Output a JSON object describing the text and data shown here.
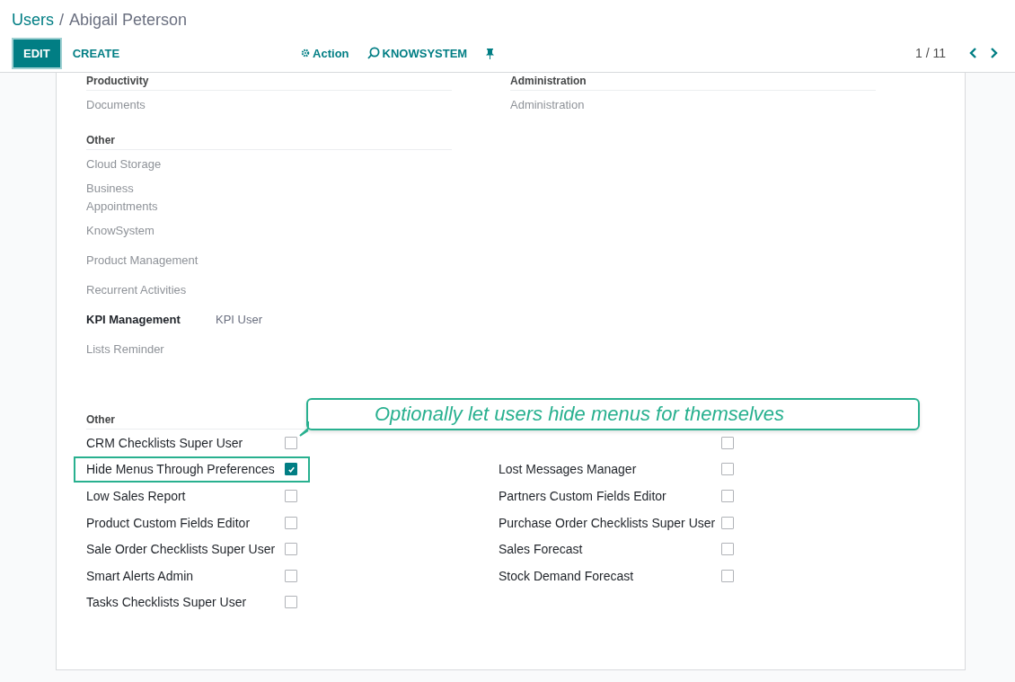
{
  "breadcrumb": {
    "parent": "Users",
    "separator": "/",
    "current": "Abigail Peterson"
  },
  "toolbar": {
    "buttons": [
      {
        "label": "EDIT",
        "kind": "primary"
      },
      {
        "label": "CREATE",
        "kind": "link"
      }
    ],
    "actions": [
      {
        "label": "Action",
        "kind": "gear"
      },
      {
        "label": "KNOWSYSTEM",
        "kind": "knowsystem"
      },
      {
        "kind": "pin"
      }
    ],
    "pager": "1 / 11"
  },
  "upper_sections": [
    {
      "title": "Productivity",
      "fields": [
        {
          "label": "Documents",
          "empty": true
        }
      ]
    },
    {
      "title": "Administration",
      "fields": [
        {
          "label": "Administration",
          "empty": true
        }
      ]
    },
    {
      "title": "Other",
      "fields": [
        {
          "label": "Cloud Storage",
          "empty": true
        },
        {
          "label": "Business Appointments",
          "empty": true
        },
        {
          "label": "KnowSystem",
          "empty": true
        },
        {
          "label": "Product Management",
          "empty": true
        },
        {
          "label": "Recurrent Activities",
          "empty": true
        },
        {
          "label": "KPI Management",
          "empty": false,
          "value": "KPI User"
        },
        {
          "label": "Lists Reminder",
          "empty": true
        }
      ]
    }
  ],
  "other_section": {
    "title": "Other",
    "left": [
      {
        "label": "CRM Checklists Super User",
        "checked": false,
        "highlighted": false
      },
      {
        "label": "Hide Menus Through Preferences",
        "checked": true,
        "highlighted": true
      },
      {
        "label": "Low Sales Report",
        "checked": false,
        "highlighted": false
      },
      {
        "label": "Product Custom Fields Editor",
        "checked": false,
        "highlighted": false
      },
      {
        "label": "Sale Order Checklists Super User",
        "checked": false,
        "highlighted": false
      },
      {
        "label": "Smart Alerts Admin",
        "checked": false,
        "highlighted": false
      },
      {
        "label": "Tasks Checklists Super User",
        "checked": false,
        "highlighted": false
      }
    ],
    "right": [
      {
        "checked": false,
        "highlighted": false
      },
      {
        "label": "Lost Messages Manager",
        "checked": false,
        "highlighted": false
      },
      {
        "label": "Partners Custom Fields Editor",
        "checked": false,
        "highlighted": false
      },
      {
        "label": "Purchase Order Checklists Super User",
        "checked": false,
        "highlighted": false
      },
      {
        "label": "Sales Forecast",
        "checked": false,
        "highlighted": false
      },
      {
        "label": "Stock Demand Forecast",
        "checked": false,
        "highlighted": false
      }
    ]
  },
  "callout": {
    "text": "Optionally let users hide menus for themselves"
  }
}
